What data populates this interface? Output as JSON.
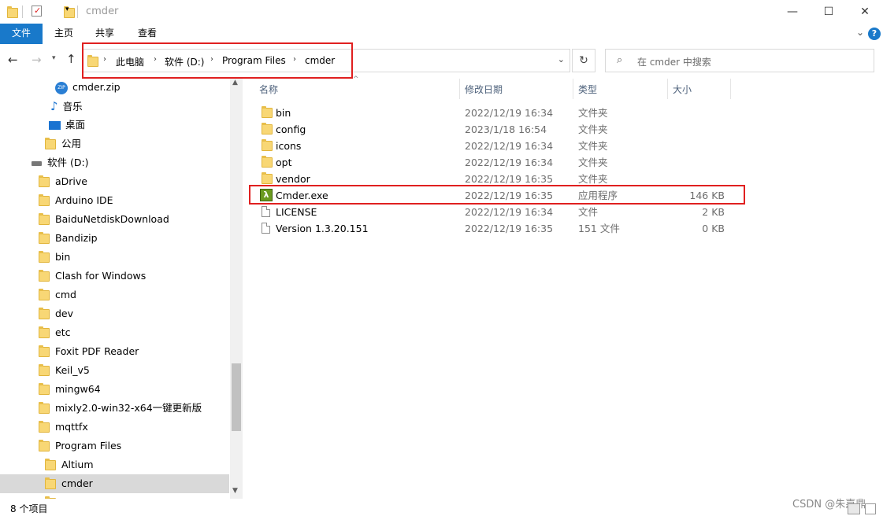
{
  "window": {
    "title": "cmder"
  },
  "ribbon": {
    "tabs": [
      "文件",
      "主页",
      "共享",
      "查看"
    ]
  },
  "address": {
    "crumbs": [
      "此电脑",
      "软件 (D:)",
      "Program Files",
      "cmder"
    ]
  },
  "search": {
    "placeholder": "在 cmder 中搜索"
  },
  "sidebar": {
    "items": [
      {
        "label": "cmder.zip",
        "icon": "zip-icon"
      },
      {
        "label": "音乐",
        "icon": "music-icon"
      },
      {
        "label": "桌面",
        "icon": "desktop-icon"
      },
      {
        "label": "公用",
        "icon": "folder-icon"
      },
      {
        "label": "软件 (D:)",
        "icon": "drive-icon"
      },
      {
        "label": "aDrive",
        "icon": "folder-icon"
      },
      {
        "label": "Arduino IDE",
        "icon": "folder-icon"
      },
      {
        "label": "BaiduNetdiskDownload",
        "icon": "folder-icon"
      },
      {
        "label": "Bandizip",
        "icon": "folder-icon"
      },
      {
        "label": "bin",
        "icon": "folder-icon"
      },
      {
        "label": "Clash for Windows",
        "icon": "folder-icon"
      },
      {
        "label": "cmd",
        "icon": "folder-icon"
      },
      {
        "label": "dev",
        "icon": "folder-icon"
      },
      {
        "label": "etc",
        "icon": "folder-icon"
      },
      {
        "label": "Foxit PDF Reader",
        "icon": "folder-icon"
      },
      {
        "label": "Keil_v5",
        "icon": "folder-icon"
      },
      {
        "label": "mingw64",
        "icon": "folder-icon"
      },
      {
        "label": "mixly2.0-win32-x64一键更新版",
        "icon": "folder-icon"
      },
      {
        "label": "mqttfx",
        "icon": "folder-icon"
      },
      {
        "label": "Program Files",
        "icon": "folder-icon"
      },
      {
        "label": "Altium",
        "icon": "folder-icon"
      },
      {
        "label": "cmder",
        "icon": "folder-icon"
      }
    ]
  },
  "columns": {
    "name": "名称",
    "date": "修改日期",
    "type": "类型",
    "size": "大小"
  },
  "files": [
    {
      "name": "bin",
      "date": "2022/12/19 16:34",
      "type": "文件夹",
      "size": "",
      "icon": "folder-icon"
    },
    {
      "name": "config",
      "date": "2023/1/18 16:54",
      "type": "文件夹",
      "size": "",
      "icon": "folder-icon"
    },
    {
      "name": "icons",
      "date": "2022/12/19 16:34",
      "type": "文件夹",
      "size": "",
      "icon": "folder-icon"
    },
    {
      "name": "opt",
      "date": "2022/12/19 16:34",
      "type": "文件夹",
      "size": "",
      "icon": "folder-icon"
    },
    {
      "name": "vendor",
      "date": "2022/12/19 16:35",
      "type": "文件夹",
      "size": "",
      "icon": "folder-icon"
    },
    {
      "name": "Cmder.exe",
      "date": "2022/12/19 16:35",
      "type": "应用程序",
      "size": "146 KB",
      "icon": "lambda-icon"
    },
    {
      "name": "LICENSE",
      "date": "2022/12/19 16:34",
      "type": "文件",
      "size": "2 KB",
      "icon": "file-icon"
    },
    {
      "name": "Version 1.3.20.151",
      "date": "2022/12/19 16:35",
      "type": "151 文件",
      "size": "0 KB",
      "icon": "file-icon"
    }
  ],
  "status": {
    "count": "8 个项目"
  },
  "watermark": "CSDN @朱嘉鼎",
  "colors": {
    "accent": "#1979ca",
    "highlight": "#e02020",
    "selected": "#cce8ff"
  }
}
